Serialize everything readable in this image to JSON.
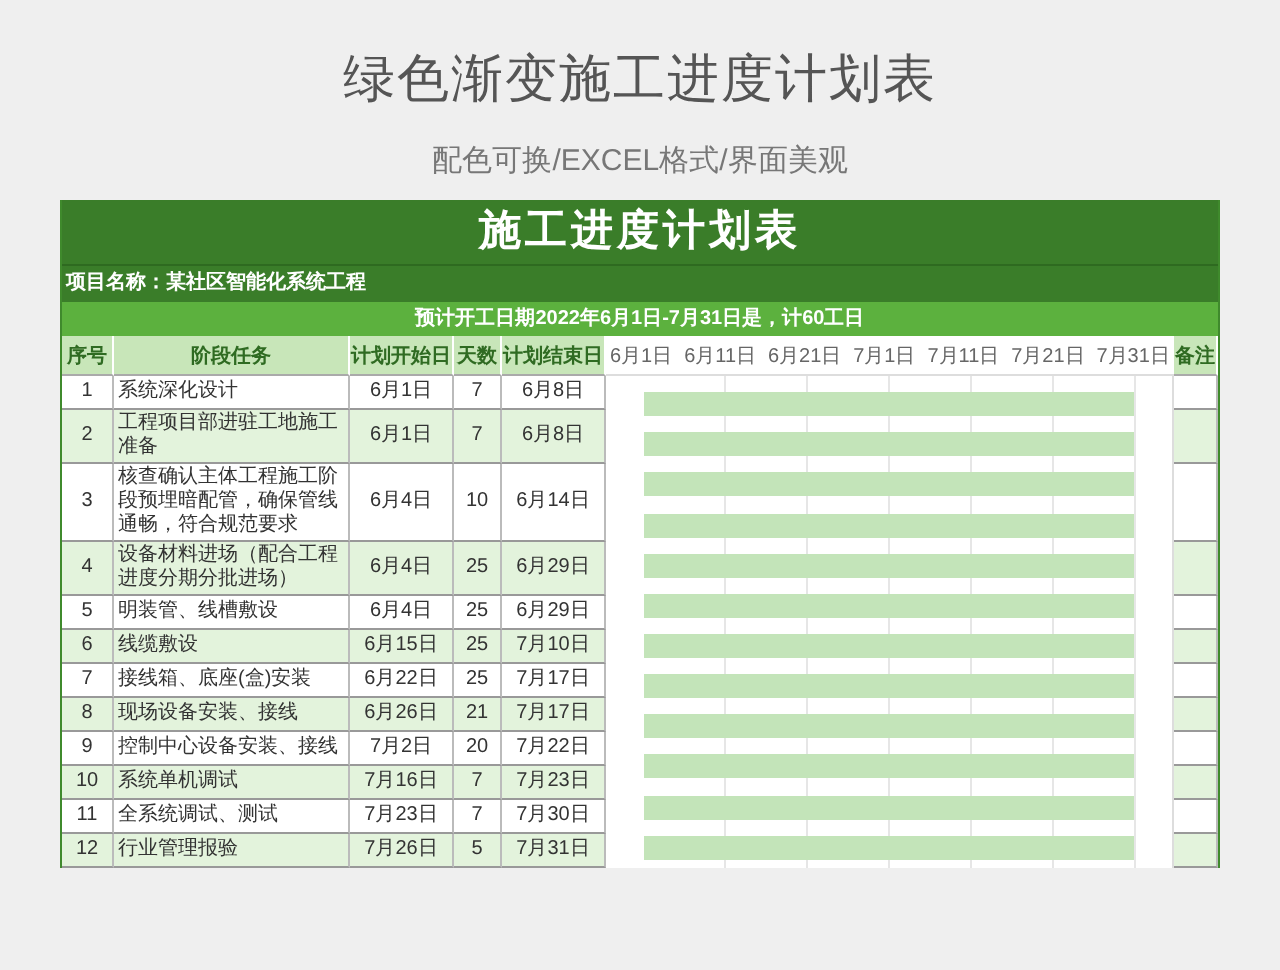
{
  "page": {
    "title": "绿色渐变施工进度计划表",
    "subtitle": "配色可换/EXCEL格式/界面美观"
  },
  "sheet": {
    "title": "施工进度计划表",
    "project": "项目名称：某社区智能化系统工程",
    "summary": "预计开工日期2022年6月1日-7月31日是，计60工日",
    "columns": [
      "序号",
      "阶段任务",
      "计划开始日",
      "天数",
      "计划结束日",
      "备注"
    ],
    "timeline_labels": [
      "6月1日",
      "6月11日",
      "6月21日",
      "7月1日",
      "7月11日",
      "7月21日",
      "7月31日"
    ],
    "rows": [
      {
        "no": "1",
        "task": "系统深化设计",
        "start": "6月1日",
        "days": "7",
        "end": "6月8日"
      },
      {
        "no": "2",
        "task": "工程项目部进驻工地施工准备",
        "start": "6月1日",
        "days": "7",
        "end": "6月8日"
      },
      {
        "no": "3",
        "task": "核查确认主体工程施工阶段预埋暗配管，确保管线通畅，符合规范要求",
        "start": "6月4日",
        "days": "10",
        "end": "6月14日"
      },
      {
        "no": "4",
        "task": "设备材料进场（配合工程进度分期分批进场）",
        "start": "6月4日",
        "days": "25",
        "end": "6月29日"
      },
      {
        "no": "5",
        "task": "明装管、线槽敷设",
        "start": "6月4日",
        "days": "25",
        "end": "6月29日"
      },
      {
        "no": "6",
        "task": "线缆敷设",
        "start": "6月15日",
        "days": "25",
        "end": "7月10日"
      },
      {
        "no": "7",
        "task": "接线箱、底座(盒)安装",
        "start": "6月22日",
        "days": "25",
        "end": "7月17日"
      },
      {
        "no": "8",
        "task": "现场设备安装、接线",
        "start": "6月26日",
        "days": "21",
        "end": "7月17日"
      },
      {
        "no": "9",
        "task": "控制中心设备安装、接线",
        "start": "7月2日",
        "days": "20",
        "end": "7月22日"
      },
      {
        "no": "10",
        "task": "系统单机调试",
        "start": "7月16日",
        "days": "7",
        "end": "7月23日"
      },
      {
        "no": "11",
        "task": "全系统调试、测试",
        "start": "7月23日",
        "days": "7",
        "end": "7月30日"
      },
      {
        "no": "12",
        "task": "行业管理报验",
        "start": "7月26日",
        "days": "5",
        "end": "7月31日"
      }
    ]
  }
}
